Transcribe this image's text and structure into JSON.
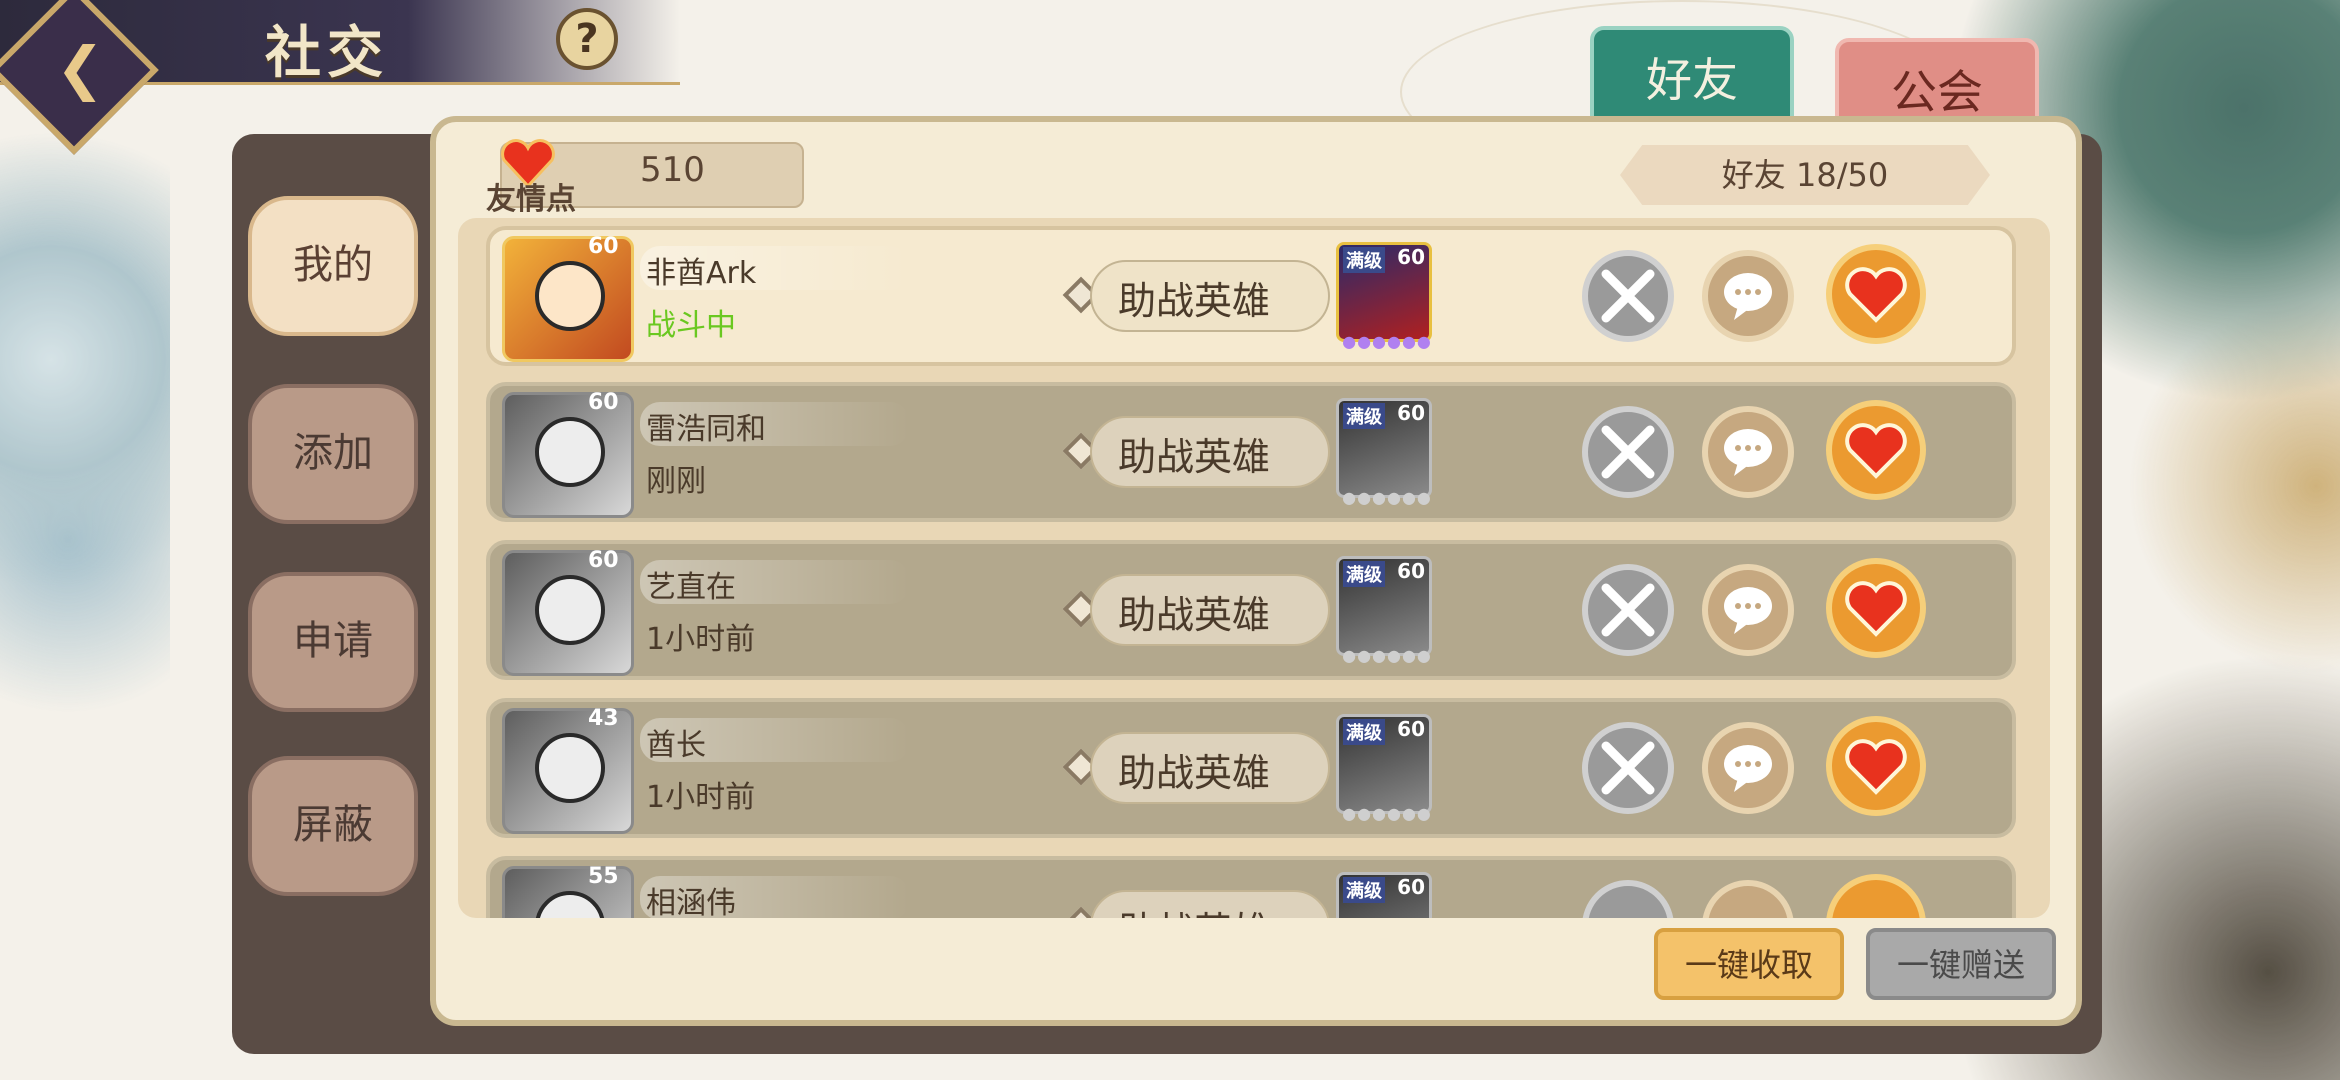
{
  "header": {
    "title": "社交",
    "help_symbol": "?"
  },
  "tabs": [
    {
      "label": "好友",
      "active": true
    },
    {
      "label": "公会",
      "active": false
    }
  ],
  "side_menu": [
    {
      "label": "我的",
      "active": true
    },
    {
      "label": "添加",
      "active": false
    },
    {
      "label": "申请",
      "active": false
    },
    {
      "label": "屏蔽",
      "active": false
    }
  ],
  "points": {
    "label": "友情点",
    "value": "510"
  },
  "friend_count": "好友 18/50",
  "helper_label": "助战英雄",
  "friends": [
    {
      "name": "非酋Ark",
      "status": "战斗中",
      "level": "60",
      "hero_tag": "满级",
      "hero_level": "60",
      "online": true
    },
    {
      "name": "雷浩同和",
      "status": "刚刚",
      "level": "60",
      "hero_tag": "满级",
      "hero_level": "60",
      "online": false
    },
    {
      "name": "艺直在",
      "status": "1小时前",
      "level": "60",
      "hero_tag": "满级",
      "hero_level": "60",
      "online": false
    },
    {
      "name": "酋长",
      "status": "1小时前",
      "level": "43",
      "hero_tag": "满级",
      "hero_level": "60",
      "online": false
    },
    {
      "name": "相涵伟",
      "status": "",
      "level": "55",
      "hero_tag": "满级",
      "hero_level": "60",
      "online": false
    }
  ],
  "footer": {
    "collect_all": "一键收取",
    "send_all": "一键赠送"
  },
  "colors": {
    "accent_green": "#2f8a76",
    "accent_red": "#e08e86",
    "online_green": "#6ac820",
    "gift_orange": "#eb9a30"
  },
  "icons": {
    "back": "back-arrow-icon",
    "heart": "heart-icon",
    "battle": "crossed-swords-icon",
    "chat": "chat-bubble-icon",
    "gift": "heart-gift-icon"
  }
}
